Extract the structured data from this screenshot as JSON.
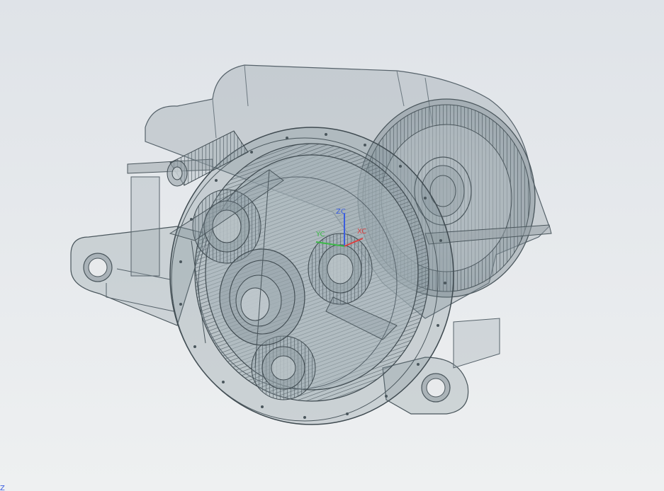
{
  "viewport": {
    "background_top": "#dfe3e8",
    "background_bottom": "#eef0f1"
  },
  "model": {
    "shell_color": "#8e9ea6",
    "edge_color": "#3f4a50"
  },
  "triad": {
    "x_label": "XC",
    "y_label": "YC",
    "z_label": "ZC",
    "x_color": "#d94040",
    "y_color": "#3cb848",
    "z_color": "#3a5de0"
  },
  "corner_triad": {
    "icon": "axis-triad-icon",
    "label": "Z",
    "color": "#3a5de0"
  }
}
